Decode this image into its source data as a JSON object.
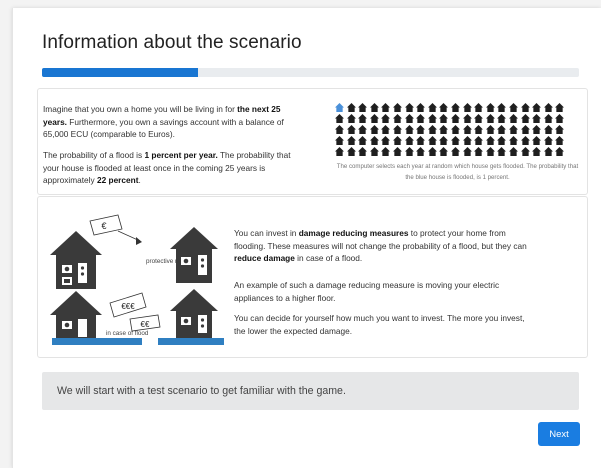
{
  "page": {
    "title": "Information about the scenario"
  },
  "progress": {
    "fraction": 0.29
  },
  "scenario": {
    "p1": [
      {
        "t": "Imagine that you own a home you will be living in for ",
        "b": false
      },
      {
        "t": "the next 25 years.",
        "b": true
      },
      {
        "t": " Furthermore, you own a savings account with a balance of 65,000 ECU (comparable to Euros).",
        "b": false
      }
    ],
    "p2": [
      {
        "t": "The probability of a flood is ",
        "b": false
      },
      {
        "t": "1 percent per year.",
        "b": true
      },
      {
        "t": " The probability that your house is flooded at least once in the coming 25 years is approximately ",
        "b": false
      },
      {
        "t": "22 percent",
        "b": true
      },
      {
        "t": ".",
        "b": false
      }
    ],
    "grid": {
      "rows": 5,
      "cols": 20,
      "highlight_index": 0,
      "house_color": "#1f1f1f",
      "highlight_color": "#4a90d9"
    },
    "caption": "The computer selects each year at random which house gets flooded. The probability that the blue house is flooded, is 1 percent."
  },
  "measures": {
    "illustration": {
      "label_protective": "protective measures",
      "label_flood": "in case of flood",
      "money_symbol_1": "€",
      "money_symbol_2": "€€€",
      "money_symbol_3": "€€"
    },
    "r1": [
      {
        "t": "You can invest in ",
        "b": false
      },
      {
        "t": "damage reducing measures",
        "b": true
      },
      {
        "t": " to protect your home from flooding. These measures will not change the probability of a flood, but they can ",
        "b": false
      },
      {
        "t": "reduce damage",
        "b": true
      },
      {
        "t": " in case of a flood.",
        "b": false
      }
    ],
    "r2": [
      {
        "t": "An example of such a damage reducing measure is moving your electric appliances to a higher floor.",
        "b": false
      }
    ],
    "r3": [
      {
        "t": "You can decide for yourself how much you want to invest. The more you invest, the lower the expected damage.",
        "b": false
      }
    ]
  },
  "banner": {
    "text": "We will start with a test scenario to get familiar with the game."
  },
  "buttons": {
    "next": "Next"
  },
  "colors": {
    "accent": "#1a7de1",
    "progress": "#1976d2",
    "water": "#2f7fc1",
    "house_dark": "#3a3a3a"
  }
}
